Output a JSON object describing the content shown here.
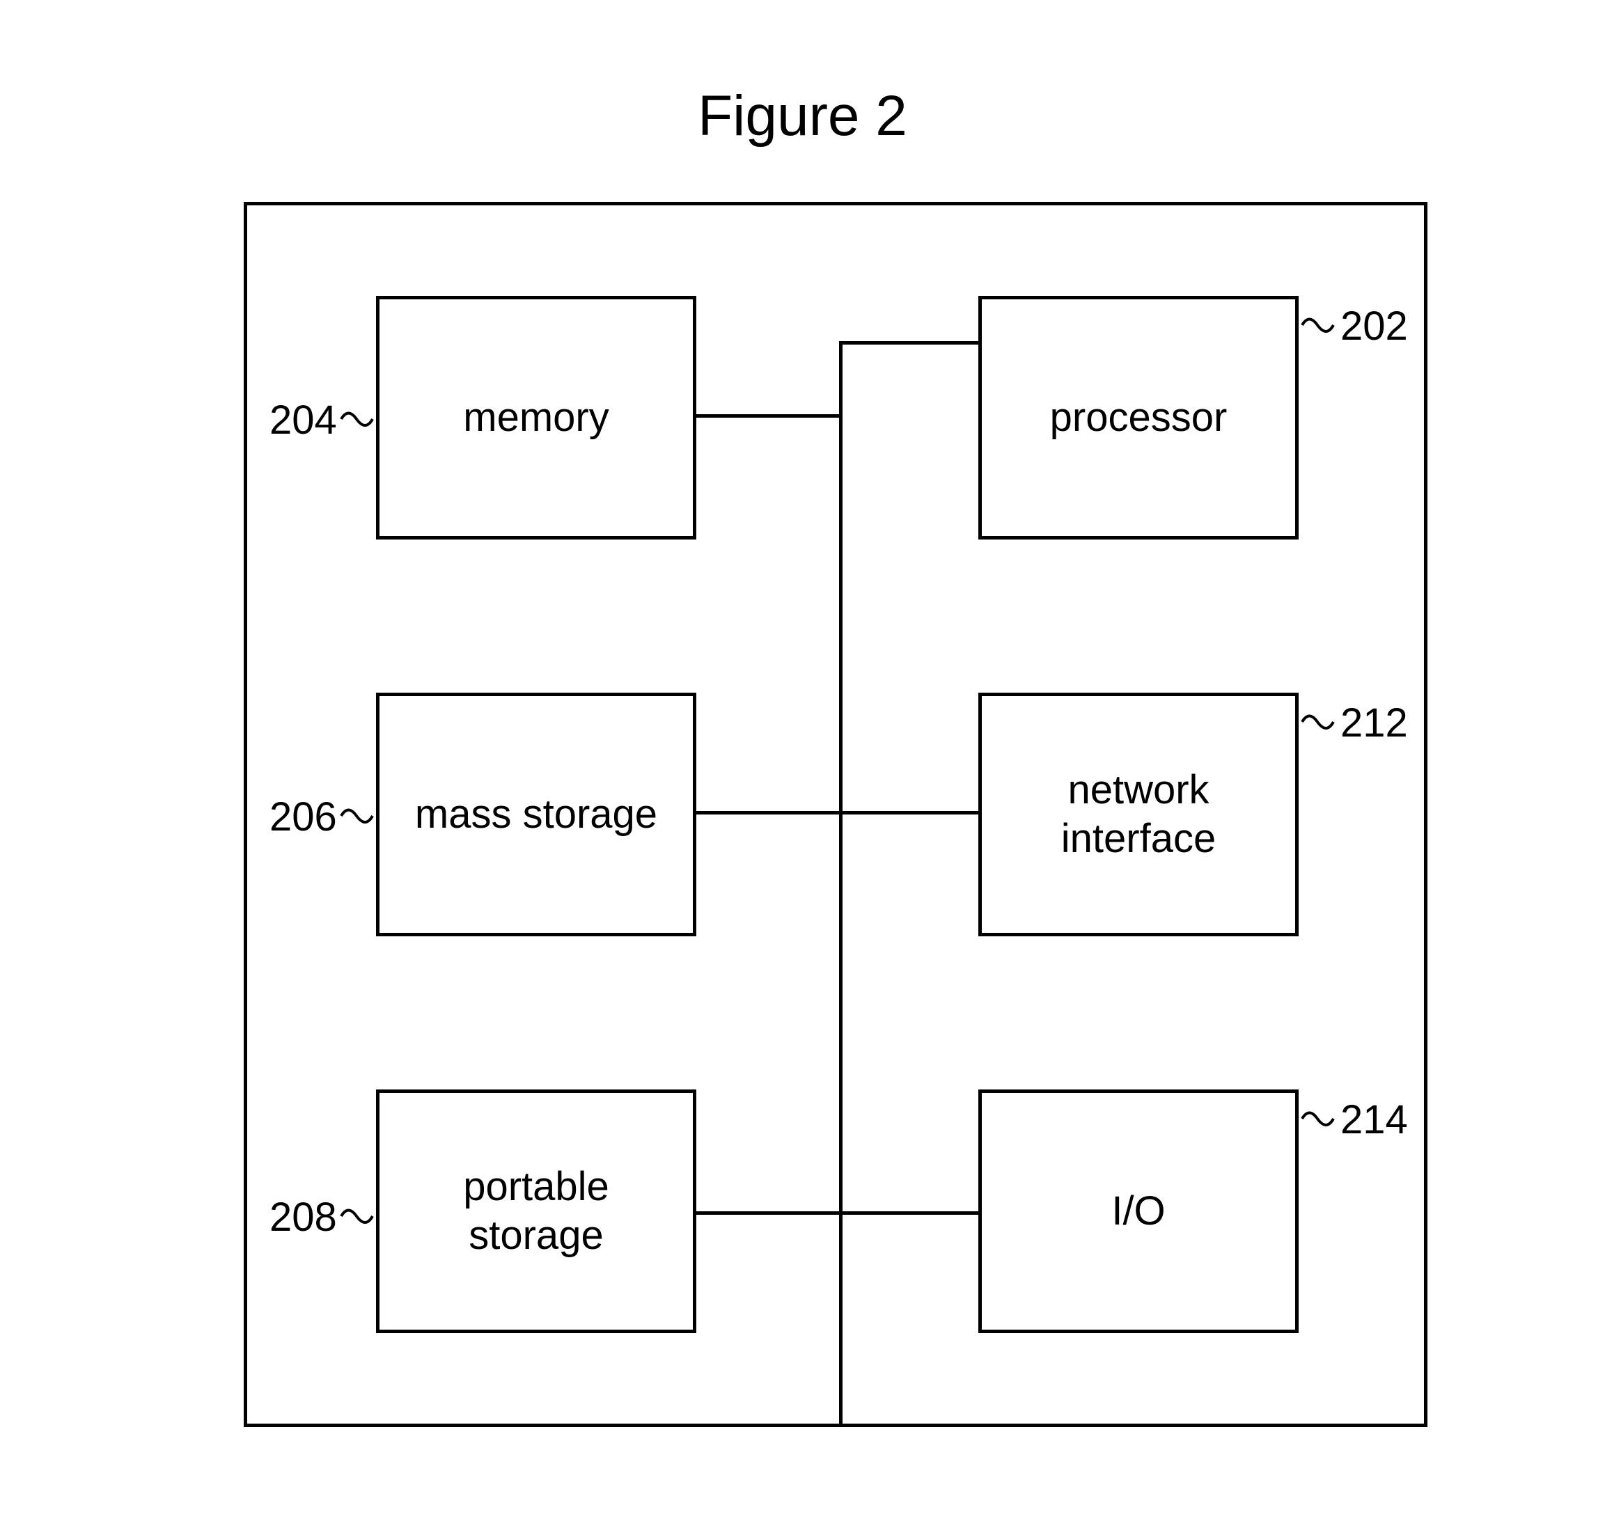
{
  "title": "Figure 2",
  "blocks": {
    "memory": {
      "label": "memory",
      "ref": "204"
    },
    "mass_storage": {
      "label": "mass storage",
      "ref": "206"
    },
    "portable_storage": {
      "label": "portable\nstorage",
      "ref": "208"
    },
    "processor": {
      "label": "processor",
      "ref": "202"
    },
    "network_interface": {
      "label": "network\ninterface",
      "ref": "212"
    },
    "io": {
      "label": "I/O",
      "ref": "214"
    }
  }
}
